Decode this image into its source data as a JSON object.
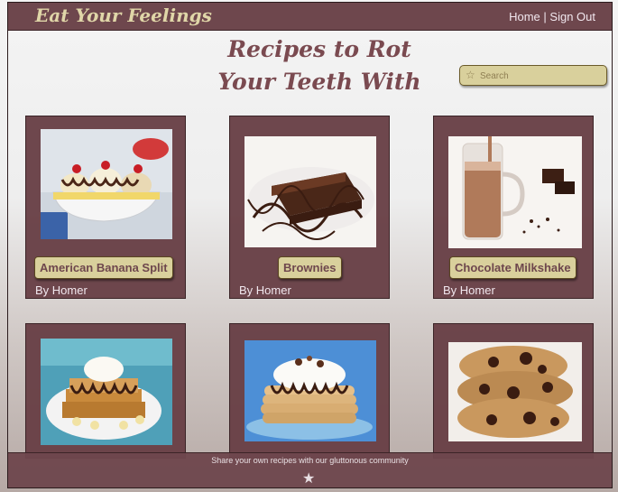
{
  "brand": {
    "name": "Eat Your Feelings"
  },
  "nav": {
    "home": "Home",
    "separator": "|",
    "signout": "Sign Out"
  },
  "page": {
    "title_line1": "Recipes to Rot",
    "title_line2": "Your Teeth With"
  },
  "search": {
    "placeholder": "Search",
    "icon": "star-icon"
  },
  "recipes": [
    {
      "title": "American Banana Split",
      "author": "By Homer"
    },
    {
      "title": "Brownies",
      "author": "By Homer"
    },
    {
      "title": "Chocolate Milkshake",
      "author": "By Homer"
    },
    {
      "title": "",
      "author": ""
    },
    {
      "title": "",
      "author": ""
    },
    {
      "title": "",
      "author": ""
    }
  ],
  "footer": {
    "tagline": "Share your own recipes with our gluttonous community",
    "icon": "star-icon"
  },
  "colors": {
    "primary": "#6e474d",
    "accent": "#d9d09c",
    "brand_text": "#e0d6a8",
    "title_text": "#7a4a50"
  }
}
